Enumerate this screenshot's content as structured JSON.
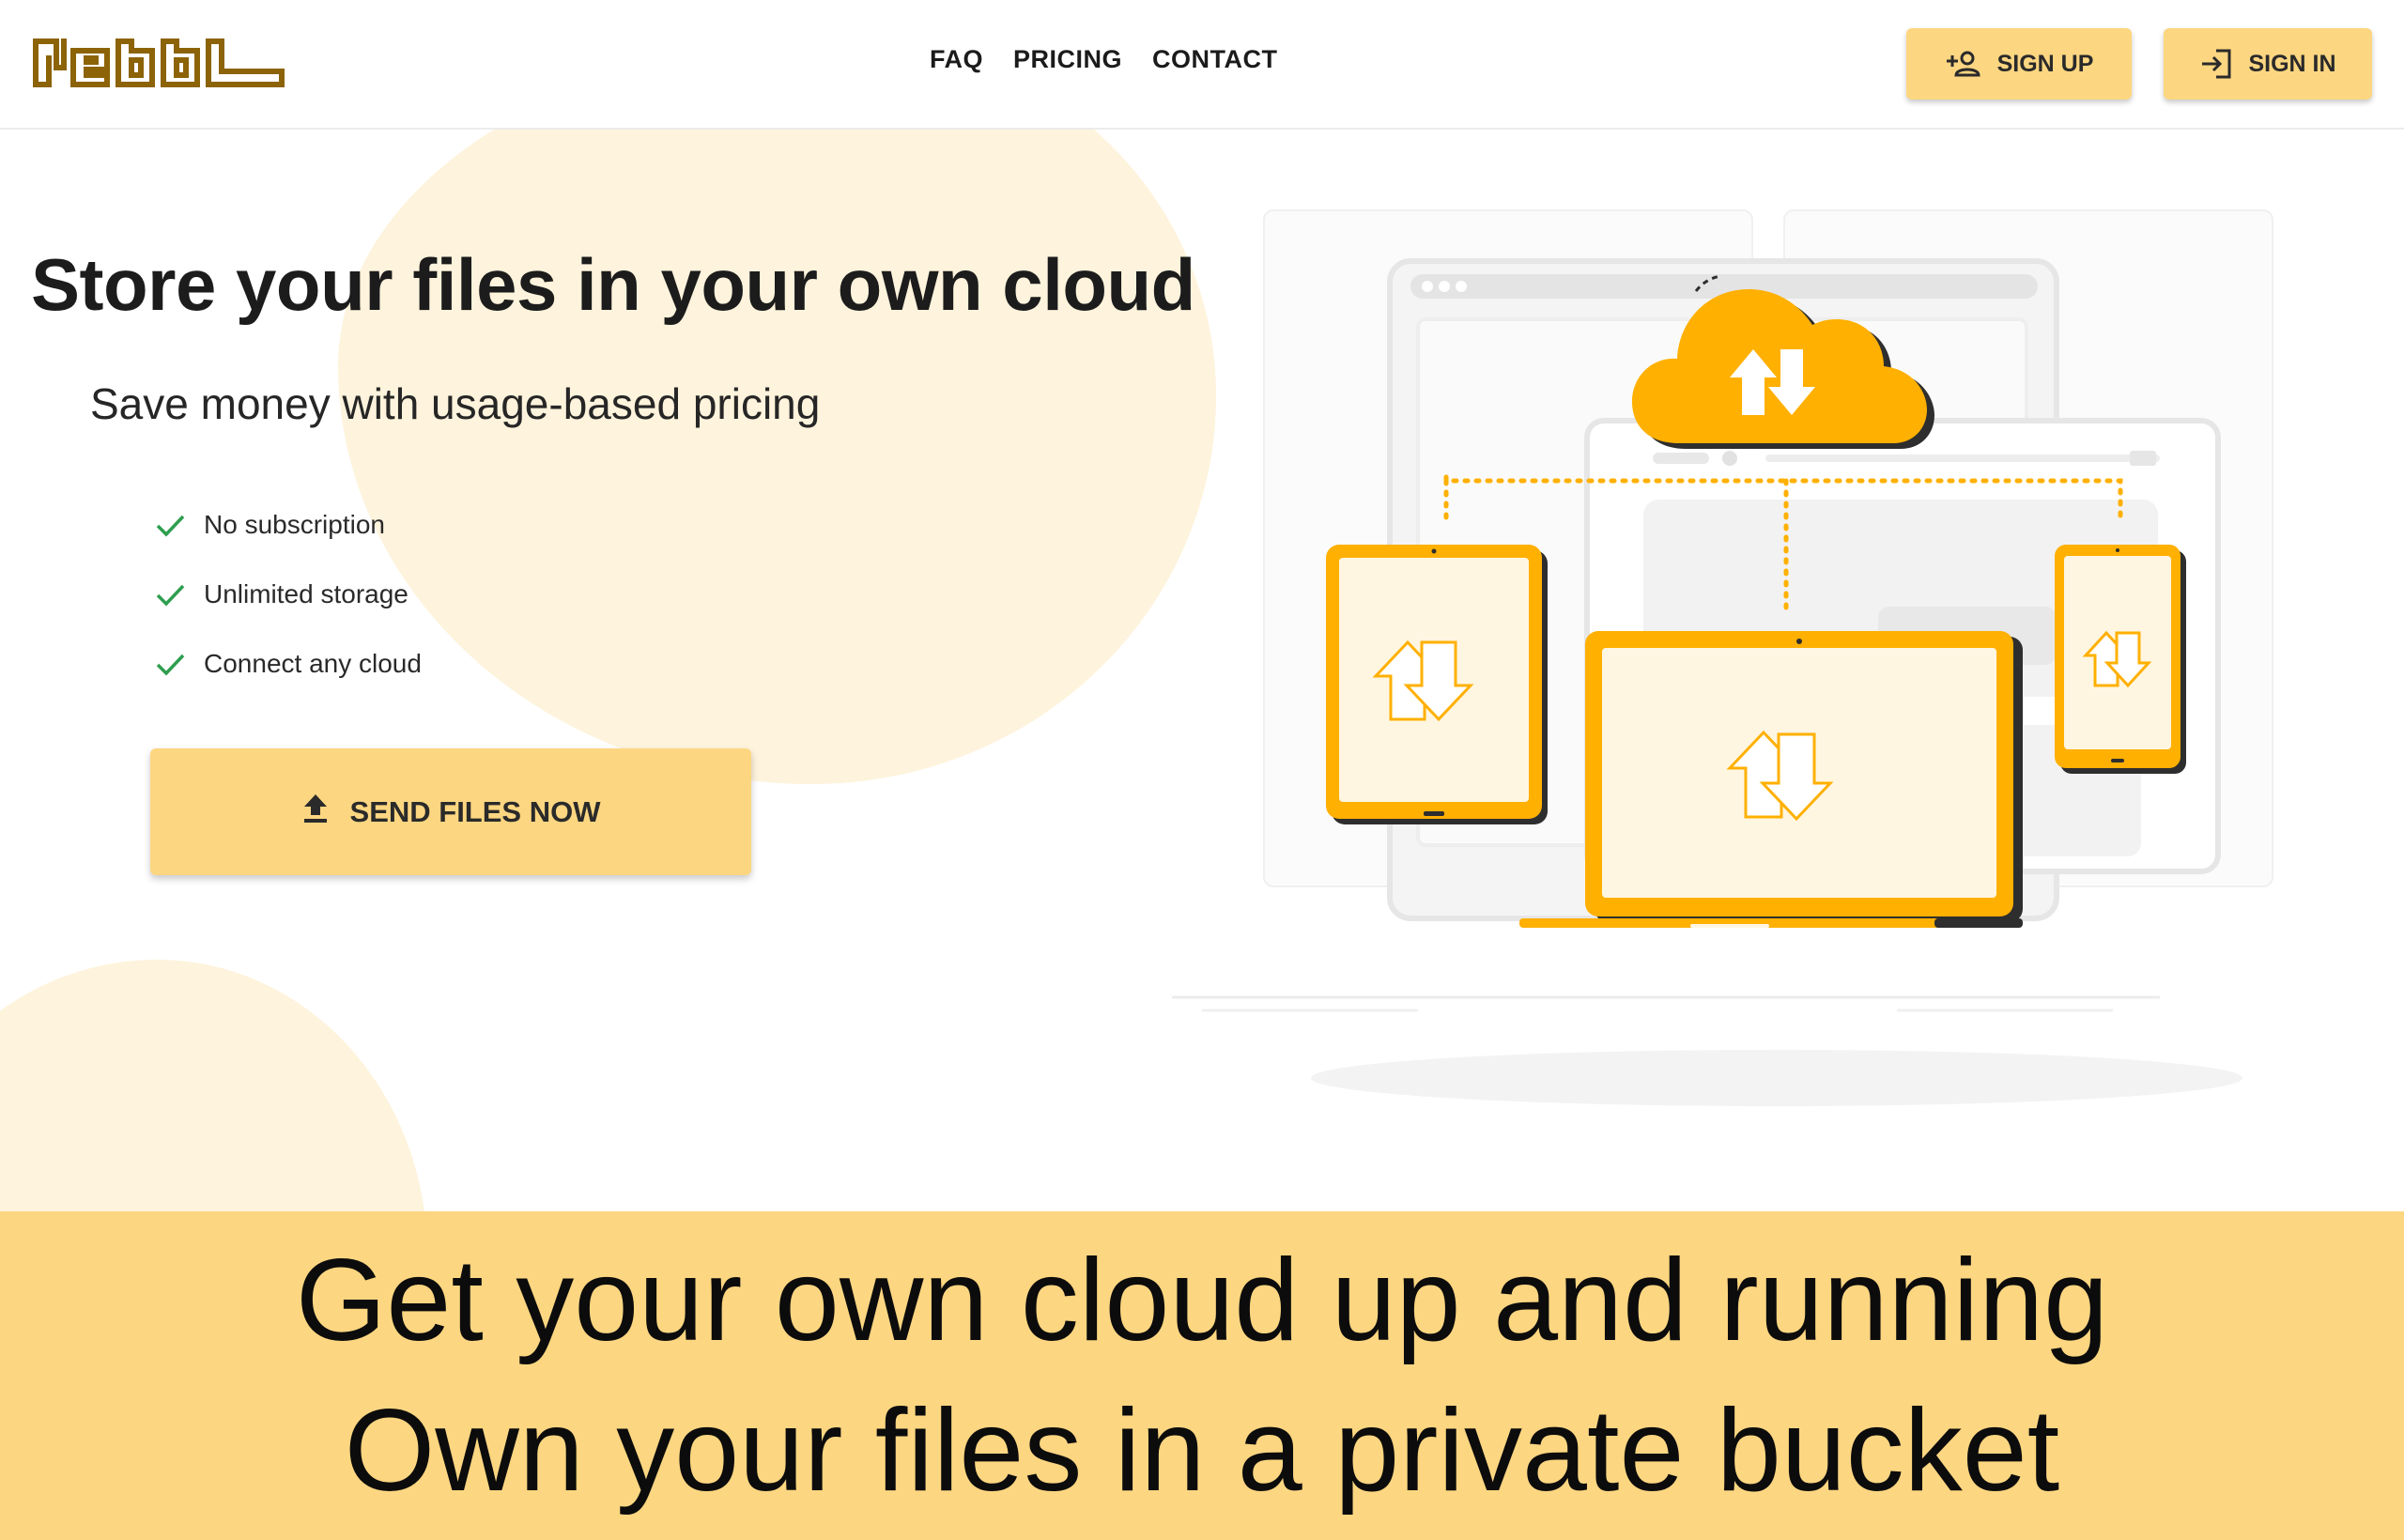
{
  "brand": {
    "logo_text": "NEBBL",
    "logo_color": "#8c6306"
  },
  "nav": {
    "items": [
      {
        "label": "FAQ"
      },
      {
        "label": "PRICING"
      },
      {
        "label": "CONTACT"
      }
    ]
  },
  "auth": {
    "sign_up_label": "SIGN UP",
    "sign_up_icon": "person-add-icon",
    "sign_in_label": "SIGN IN",
    "sign_in_icon": "login-icon"
  },
  "hero": {
    "title": "Store your files in your own cloud",
    "subtitle": "Save money with usage-based pricing",
    "features": [
      {
        "label": "No subscription",
        "icon": "check-icon"
      },
      {
        "label": "Unlimited storage",
        "icon": "check-icon"
      },
      {
        "label": "Connect any cloud",
        "icon": "check-icon"
      }
    ],
    "cta_label": "SEND FILES NOW",
    "cta_icon": "upload-icon"
  },
  "illustration": {
    "icon": "cloud-sync-illustration"
  },
  "banner": {
    "line1": "Get your own cloud up and running",
    "line2": "Own your files in a private bucket"
  },
  "colors": {
    "accent": "#fdd681",
    "illustration_orange": "#ffb000",
    "blob": "#fef3dc",
    "check_green": "#2e9e4f",
    "text_dark": "#1c1c1c"
  }
}
